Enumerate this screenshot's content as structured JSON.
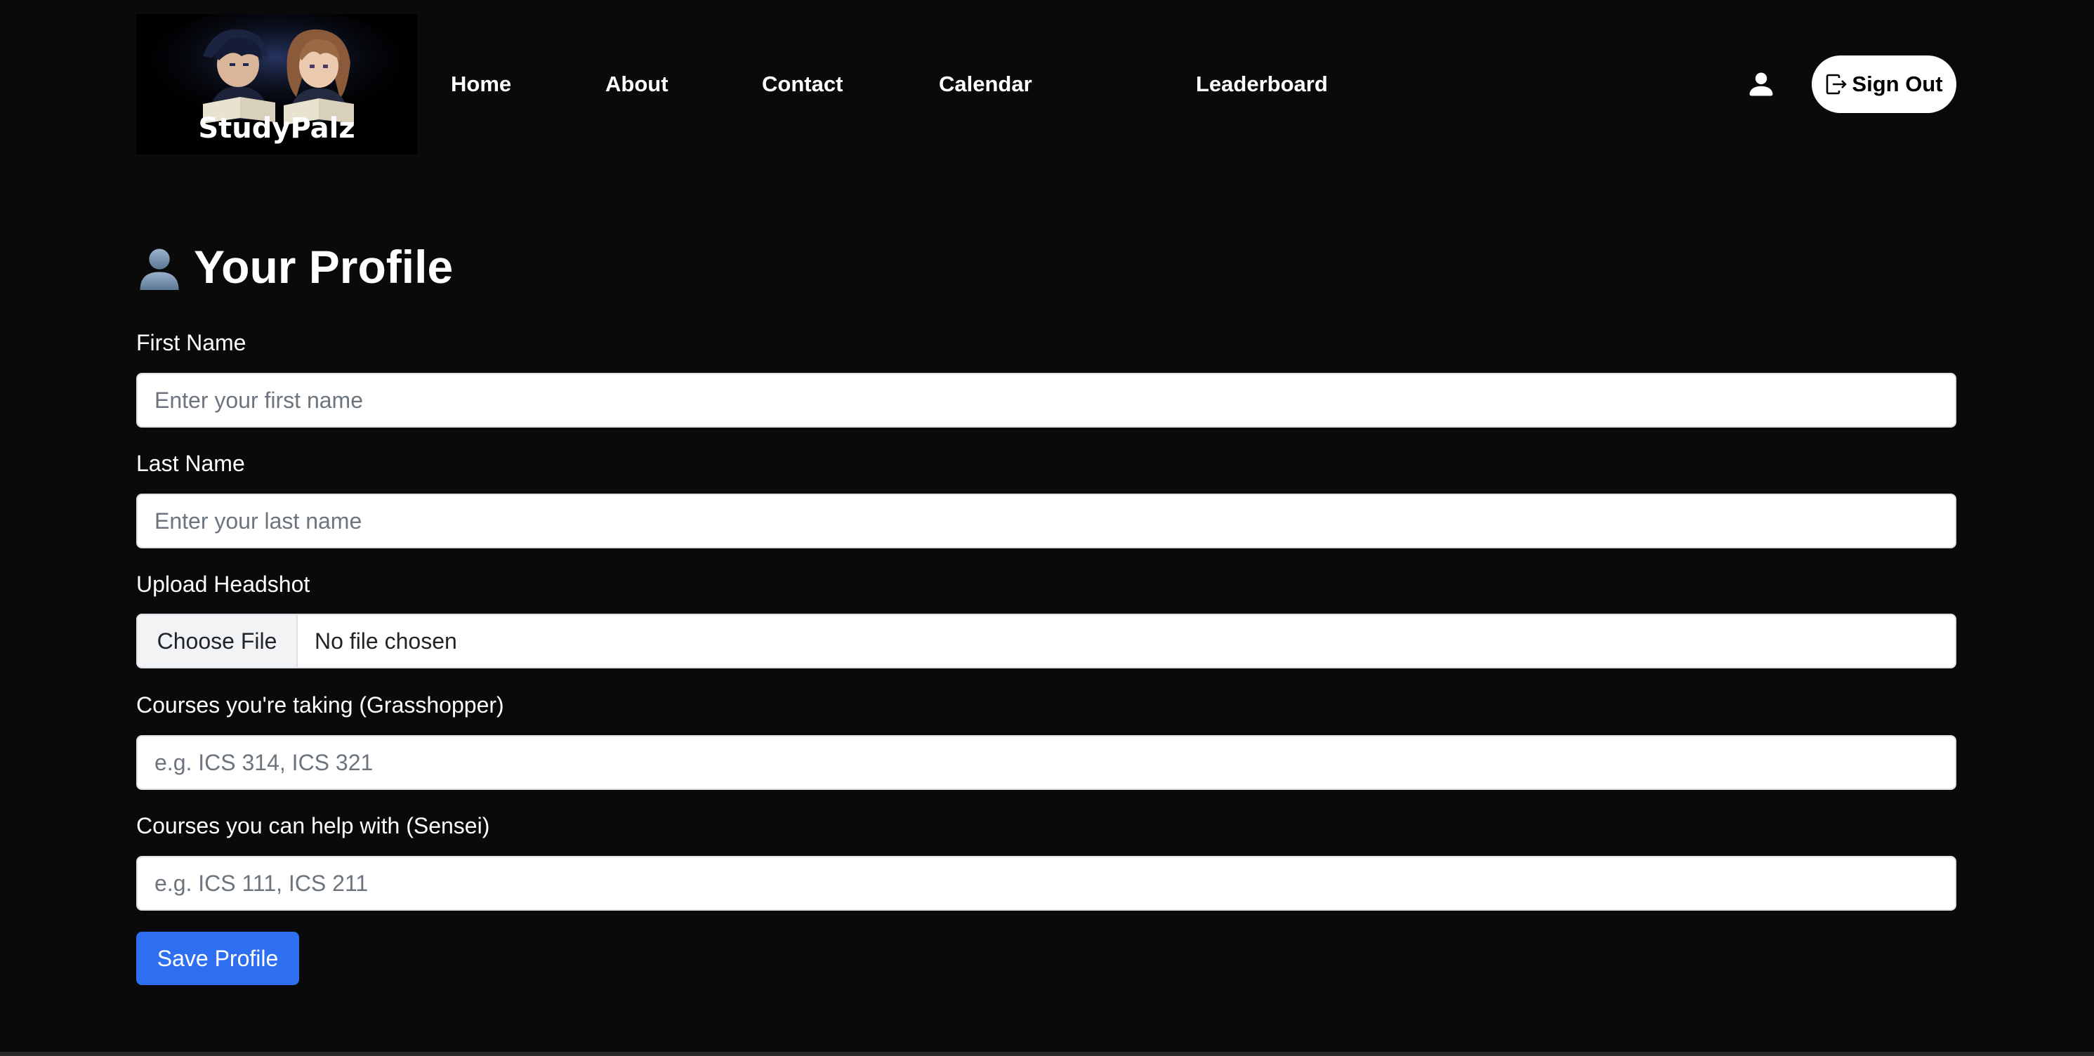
{
  "nav": {
    "logo_text": "StudyPalz",
    "links": [
      "Home",
      "About",
      "Contact",
      "Calendar",
      "Leaderboard"
    ],
    "user_icon": "user-icon",
    "signout_label": "Sign Out",
    "signout_icon": "box-arrow-right-icon"
  },
  "page": {
    "title_icon": "bust-in-silhouette-icon",
    "title": "Your Profile"
  },
  "form": {
    "first_name": {
      "label": "First Name",
      "placeholder": "Enter your first name",
      "value": ""
    },
    "last_name": {
      "label": "Last Name",
      "placeholder": "Enter your last name",
      "value": ""
    },
    "headshot": {
      "label": "Upload Headshot",
      "button": "Choose File",
      "status": "No file chosen"
    },
    "courses_taking": {
      "label": "Courses you're taking (Grasshopper)",
      "placeholder": "e.g. ICS 314, ICS 321",
      "value": ""
    },
    "courses_help": {
      "label": "Courses you can help with (Sensei)",
      "placeholder": "e.g. ICS 111, ICS 211",
      "value": ""
    },
    "save_label": "Save Profile"
  },
  "colors": {
    "background": "#0a0a0a",
    "primary_button": "#2e6ff2",
    "signout_bg": "#ffffff"
  }
}
